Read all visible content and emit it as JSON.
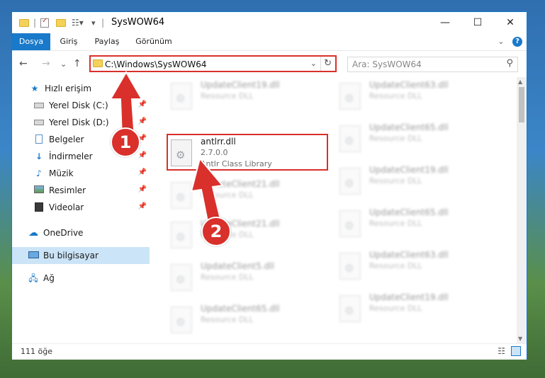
{
  "window": {
    "title": "SysWOW64",
    "minimize_glyph": "—",
    "maximize_glyph": "☐",
    "close_glyph": "✕"
  },
  "ribbon": {
    "tabs": [
      "Dosya",
      "Giriş",
      "Paylaş",
      "Görünüm"
    ],
    "expand_glyph": "⌄",
    "help_glyph": "?"
  },
  "navigation": {
    "back_glyph": "←",
    "forward_glyph": "→",
    "recent_glyph": "⌄",
    "up_glyph": "↑",
    "address": "C:\\Windows\\SysWOW64",
    "address_dropdown_glyph": "⌄",
    "refresh_glyph": "↻",
    "search_placeholder": "Ara: SysWOW64",
    "search_glyph": "⚲"
  },
  "sidebar": {
    "items": [
      {
        "label": "Hızlı erişim",
        "icon": "star-icon"
      },
      {
        "label": "Yerel Disk (C:)",
        "icon": "drive-icon",
        "pinned": true
      },
      {
        "label": "Yerel Disk (D:)",
        "icon": "drive-icon",
        "pinned": true
      },
      {
        "label": "Belgeler",
        "icon": "documents-icon",
        "pinned": true
      },
      {
        "label": "İndirmeler",
        "icon": "downloads-icon",
        "pinned": true
      },
      {
        "label": "Müzik",
        "icon": "music-icon",
        "pinned": true
      },
      {
        "label": "Resimler",
        "icon": "pictures-icon",
        "pinned": true
      },
      {
        "label": "Videolar",
        "icon": "videos-icon",
        "pinned": true
      },
      {
        "label": "OneDrive",
        "icon": "cloud-icon"
      },
      {
        "label": "Bu bilgisayar",
        "icon": "computer-icon",
        "selected": true
      },
      {
        "label": "Ağ",
        "icon": "network-icon"
      }
    ],
    "pin_glyph": "📌"
  },
  "files": {
    "highlighted": {
      "name": "antlrr.dll",
      "version": "2.7.0.0",
      "description": "Antlr Class Library"
    },
    "left_column": [
      {
        "name": "UpdateClient19.dll",
        "type": "Resource DLL"
      },
      {
        "name": "UpdateClient21.dll",
        "type": "Resource DLL"
      },
      {
        "name": "UpdateClient21.dll",
        "type": "Resource DLL"
      },
      {
        "name": "UpdateClient5.dll",
        "type": "Resource DLL"
      },
      {
        "name": "UpdateClient65.dll",
        "type": "Resource DLL"
      }
    ],
    "right_column": [
      {
        "name": "UpdateClient63.dll",
        "type": "Resource DLL"
      },
      {
        "name": "UpdateClient65.dll",
        "type": "Resource DLL"
      },
      {
        "name": "UpdateClient19.dll",
        "type": "Resource DLL"
      },
      {
        "name": "UpdateClient65.dll",
        "type": "Resource DLL"
      },
      {
        "name": "UpdateClient63.dll",
        "type": "Resource DLL"
      },
      {
        "name": "UpdateClient19.dll",
        "type": "Resource DLL"
      }
    ]
  },
  "status": {
    "item_count": "111 öğe"
  },
  "annotations": {
    "step1": "1",
    "step2": "2",
    "color": "#d9302c"
  }
}
